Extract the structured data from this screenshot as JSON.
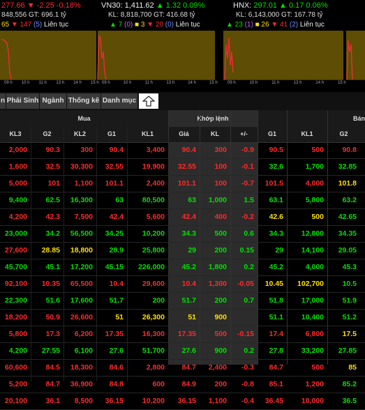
{
  "indices": [
    {
      "l1_parts": [
        {
          "text": "277.66",
          "c": "r"
        },
        {
          "text": " ▼ -2.25 -0.18%",
          "c": "r"
        }
      ],
      "l2": "848,556 GT: 696.1 tỷ",
      "l3_parts": [
        {
          "text": "65",
          "c": "y"
        },
        {
          "text": " ▼ 147",
          "c": "r"
        },
        {
          "text": " (5)",
          "c": "b"
        },
        {
          "text": " Liên tục",
          "c": "w"
        }
      ]
    },
    {
      "l1_parts": [
        {
          "text": "VN30: ",
          "c": "w"
        },
        {
          "text": "1,411.62",
          "c": "w"
        },
        {
          "text": " ▲ 1.32 0.09%",
          "c": "g"
        }
      ],
      "l2": "KL: 8,818,700 GT: 416.68 tỷ",
      "l3_parts": [
        {
          "text": "▲ 7",
          "c": "g"
        },
        {
          "text": " (0)",
          "c": "p"
        },
        {
          "text": " ■ 3",
          "c": "y"
        },
        {
          "text": " ▼ 20",
          "c": "r"
        },
        {
          "text": " (0)",
          "c": "b"
        },
        {
          "text": " Liên tục",
          "c": "w"
        }
      ]
    },
    {
      "l1_parts": [
        {
          "text": "HNX: ",
          "c": "w"
        },
        {
          "text": "297.01",
          "c": "g"
        },
        {
          "text": " ▲ 0.17 0.06%",
          "c": "g"
        }
      ],
      "l2": "KL: 6,143,000 GT: 167.78 tỷ",
      "l3_parts": [
        {
          "text": "▲ 23",
          "c": "g"
        },
        {
          "text": " (1)",
          "c": "p"
        },
        {
          "text": " ■ 26",
          "c": "y"
        },
        {
          "text": " ▼ 41",
          "c": "r"
        },
        {
          "text": " (2)",
          "c": "b"
        },
        {
          "text": " Liên tục",
          "c": "w"
        }
      ]
    }
  ],
  "chart_times": [
    "09 h",
    "10 h",
    "11 h",
    "13 h",
    "14 h",
    "15 h"
  ],
  "tabs": [
    "n",
    "Phái Sinh",
    "Ngành",
    "Thống kê",
    "Danh mục"
  ],
  "headers": {
    "mua": "Mua",
    "khop": "Khớp lệnh",
    "ban": "Bán",
    "cols": [
      "KL3",
      "G2",
      "KL2",
      "G1",
      "KL1",
      "Giá",
      "KL",
      "+/-",
      "G1",
      "KL1",
      "G2"
    ]
  },
  "rows": [
    [
      [
        "2,000",
        "r"
      ],
      [
        "90.3",
        "r"
      ],
      [
        "300",
        "r"
      ],
      [
        "90.4",
        "r"
      ],
      [
        "3,400",
        "r"
      ],
      [
        "90.4",
        "r"
      ],
      [
        "300",
        "r"
      ],
      [
        "-0.9",
        "r"
      ],
      [
        "90.5",
        "r"
      ],
      [
        "500",
        "r"
      ],
      [
        "90.8",
        "r"
      ]
    ],
    [
      [
        "1,600",
        "r"
      ],
      [
        "32.5",
        "r"
      ],
      [
        "30,300",
        "r"
      ],
      [
        "32.55",
        "r"
      ],
      [
        "19,900",
        "r"
      ],
      [
        "32.55",
        "r"
      ],
      [
        "100",
        "r"
      ],
      [
        "-0.1",
        "r"
      ],
      [
        "32.6",
        "g"
      ],
      [
        "1,700",
        "g"
      ],
      [
        "32.85",
        "g"
      ]
    ],
    [
      [
        "5,000",
        "r"
      ],
      [
        "101",
        "r"
      ],
      [
        "1,100",
        "r"
      ],
      [
        "101.1",
        "r"
      ],
      [
        "2,400",
        "r"
      ],
      [
        "101.1",
        "r"
      ],
      [
        "100",
        "r"
      ],
      [
        "-0.7",
        "r"
      ],
      [
        "101.5",
        "r"
      ],
      [
        "4,000",
        "r"
      ],
      [
        "101.8",
        "y"
      ]
    ],
    [
      [
        "9,400",
        "g"
      ],
      [
        "62.5",
        "g"
      ],
      [
        "16,300",
        "g"
      ],
      [
        "63",
        "g"
      ],
      [
        "80,500",
        "g"
      ],
      [
        "63",
        "g"
      ],
      [
        "1,000",
        "g"
      ],
      [
        "1.5",
        "g"
      ],
      [
        "63.1",
        "g"
      ],
      [
        "5,800",
        "g"
      ],
      [
        "63.2",
        "g"
      ]
    ],
    [
      [
        "4,200",
        "r"
      ],
      [
        "42.3",
        "r"
      ],
      [
        "7,500",
        "r"
      ],
      [
        "42.4",
        "r"
      ],
      [
        "5,600",
        "r"
      ],
      [
        "42.4",
        "r"
      ],
      [
        "400",
        "r"
      ],
      [
        "-0.2",
        "r"
      ],
      [
        "42.6",
        "y"
      ],
      [
        "500",
        "y"
      ],
      [
        "42.65",
        "g"
      ]
    ],
    [
      [
        "23,000",
        "g"
      ],
      [
        "34.2",
        "g"
      ],
      [
        "56,500",
        "g"
      ],
      [
        "34.25",
        "g"
      ],
      [
        "10,200",
        "g"
      ],
      [
        "34.3",
        "g"
      ],
      [
        "500",
        "g"
      ],
      [
        "0.6",
        "g"
      ],
      [
        "34.3",
        "g"
      ],
      [
        "12,800",
        "g"
      ],
      [
        "34.35",
        "g"
      ]
    ],
    [
      [
        "27,600",
        "r"
      ],
      [
        "28.85",
        "y"
      ],
      [
        "18,800",
        "y"
      ],
      [
        "28.9",
        "g"
      ],
      [
        "25,800",
        "g"
      ],
      [
        "29",
        "g"
      ],
      [
        "200",
        "g"
      ],
      [
        "0.15",
        "g"
      ],
      [
        "29",
        "g"
      ],
      [
        "14,100",
        "g"
      ],
      [
        "29.05",
        "g"
      ]
    ],
    [
      [
        "45,700",
        "g"
      ],
      [
        "45.1",
        "g"
      ],
      [
        "17,200",
        "g"
      ],
      [
        "45.15",
        "g"
      ],
      [
        "226,000",
        "g"
      ],
      [
        "45.2",
        "g"
      ],
      [
        "1,800",
        "g"
      ],
      [
        "0.2",
        "g"
      ],
      [
        "45.2",
        "g"
      ],
      [
        "4,000",
        "g"
      ],
      [
        "45.3",
        "g"
      ]
    ],
    [
      [
        "92,100",
        "r"
      ],
      [
        "10.35",
        "r"
      ],
      [
        "65,500",
        "r"
      ],
      [
        "10.4",
        "r"
      ],
      [
        "29,600",
        "r"
      ],
      [
        "10.4",
        "r"
      ],
      [
        "1,300",
        "r"
      ],
      [
        "-0.05",
        "r"
      ],
      [
        "10.45",
        "y"
      ],
      [
        "102,700",
        "y"
      ],
      [
        "10.5",
        "g"
      ]
    ],
    [
      [
        "22,300",
        "g"
      ],
      [
        "51.6",
        "g"
      ],
      [
        "17,600",
        "g"
      ],
      [
        "51.7",
        "g"
      ],
      [
        "200",
        "g"
      ],
      [
        "51.7",
        "g"
      ],
      [
        "200",
        "g"
      ],
      [
        "0.7",
        "g"
      ],
      [
        "51.8",
        "g"
      ],
      [
        "17,000",
        "g"
      ],
      [
        "51.9",
        "g"
      ]
    ],
    [
      [
        "18,200",
        "r"
      ],
      [
        "50.9",
        "r"
      ],
      [
        "26,600",
        "r"
      ],
      [
        "51",
        "y"
      ],
      [
        "26,300",
        "y"
      ],
      [
        "51",
        "y"
      ],
      [
        "900",
        "y"
      ],
      [
        "",
        "y"
      ],
      [
        "51.1",
        "g"
      ],
      [
        "10,400",
        "g"
      ],
      [
        "51.2",
        "g"
      ]
    ],
    [
      [
        "5,800",
        "r"
      ],
      [
        "17.3",
        "r"
      ],
      [
        "6,200",
        "r"
      ],
      [
        "17.35",
        "r"
      ],
      [
        "16,300",
        "r"
      ],
      [
        "17.35",
        "r"
      ],
      [
        "500",
        "r"
      ],
      [
        "-0.15",
        "r"
      ],
      [
        "17.4",
        "r"
      ],
      [
        "6,800",
        "r"
      ],
      [
        "17.5",
        "y"
      ]
    ],
    [
      [
        "4,200",
        "g"
      ],
      [
        "27.55",
        "g"
      ],
      [
        "6,100",
        "g"
      ],
      [
        "27.6",
        "g"
      ],
      [
        "51,700",
        "g"
      ],
      [
        "27.6",
        "g"
      ],
      [
        "900",
        "g"
      ],
      [
        "0.2",
        "g"
      ],
      [
        "27.8",
        "g"
      ],
      [
        "33,200",
        "g"
      ],
      [
        "27.85",
        "g"
      ]
    ],
    [
      [
        "60,600",
        "r"
      ],
      [
        "84.5",
        "r"
      ],
      [
        "18,300",
        "r"
      ],
      [
        "84.6",
        "r"
      ],
      [
        "2,800",
        "r"
      ],
      [
        "84.7",
        "r"
      ],
      [
        "2,400",
        "r"
      ],
      [
        "-0.3",
        "r"
      ],
      [
        "84.7",
        "r"
      ],
      [
        "500",
        "r"
      ],
      [
        "85",
        "y"
      ]
    ],
    [
      [
        "5,200",
        "r"
      ],
      [
        "84.7",
        "r"
      ],
      [
        "36,900",
        "r"
      ],
      [
        "84.8",
        "r"
      ],
      [
        "600",
        "r"
      ],
      [
        "84.9",
        "r"
      ],
      [
        "200",
        "r"
      ],
      [
        "-0.8",
        "r"
      ],
      [
        "85.1",
        "r"
      ],
      [
        "1,200",
        "r"
      ],
      [
        "85.2",
        "g"
      ]
    ],
    [
      [
        "20,100",
        "r"
      ],
      [
        "36.1",
        "r"
      ],
      [
        "8,500",
        "r"
      ],
      [
        "36.15",
        "r"
      ],
      [
        "10,200",
        "r"
      ],
      [
        "36.15",
        "r"
      ],
      [
        "1,100",
        "r"
      ],
      [
        "-0.4",
        "r"
      ],
      [
        "36.45",
        "r"
      ],
      [
        "10,000",
        "r"
      ],
      [
        "36.5",
        "g"
      ]
    ]
  ],
  "colors": {
    "red": "#ff2a2a",
    "green": "#00e000",
    "yellow": "#ffe000",
    "chart_bg": "#5e4d05"
  }
}
